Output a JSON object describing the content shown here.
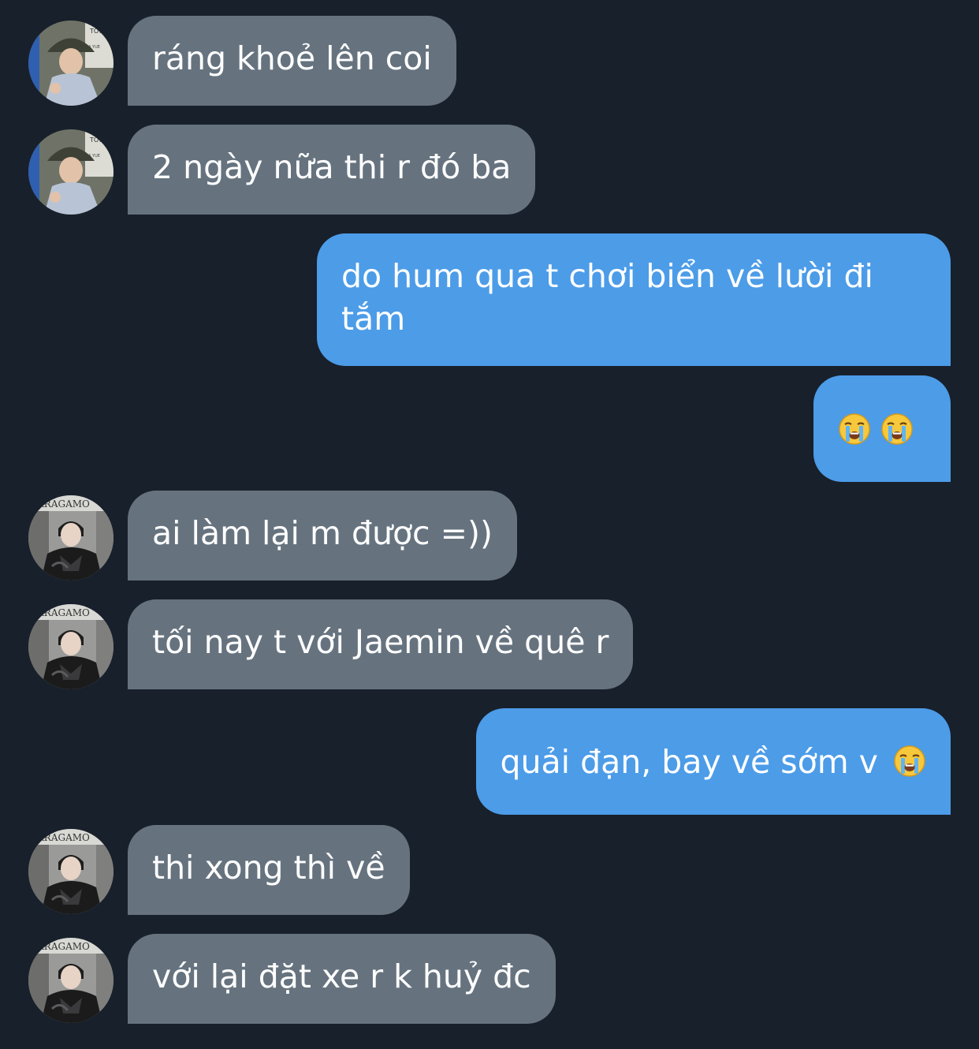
{
  "chat": {
    "messages": [
      {
        "sender": "other_1",
        "direction": "in",
        "text": "ráng khoẻ lên coi"
      },
      {
        "sender": "other_1",
        "direction": "in",
        "text": "2 ngày nữa thi r đó ba"
      },
      {
        "sender": "me",
        "direction": "out",
        "text": "do hum qua t chơi biển về lười đi tắm"
      },
      {
        "sender": "me",
        "direction": "out",
        "text": "",
        "emoji": [
          "loudly-crying-face",
          "loudly-crying-face"
        ]
      },
      {
        "sender": "other_2",
        "direction": "in",
        "text": "ai làm lại m được =))"
      },
      {
        "sender": "other_2",
        "direction": "in",
        "text": "tối nay t với Jaemin về quê r"
      },
      {
        "sender": "me",
        "direction": "out",
        "text": "quải đạn, bay về sớm v",
        "emoji": [
          "loudly-crying-face"
        ]
      },
      {
        "sender": "other_2",
        "direction": "in",
        "text": "thi xong thì về"
      },
      {
        "sender": "other_2",
        "direction": "in",
        "text": "với lại đặt xe r k huỷ đc"
      }
    ]
  },
  "avatar_photo_text": {
    "other_1": "TOW",
    "other_2": "ERRAGAMO"
  },
  "colors": {
    "background": "#18202b",
    "incoming_bubble": "#66737f",
    "outgoing_bubble": "#4c9ce8",
    "text": "#ffffff"
  }
}
